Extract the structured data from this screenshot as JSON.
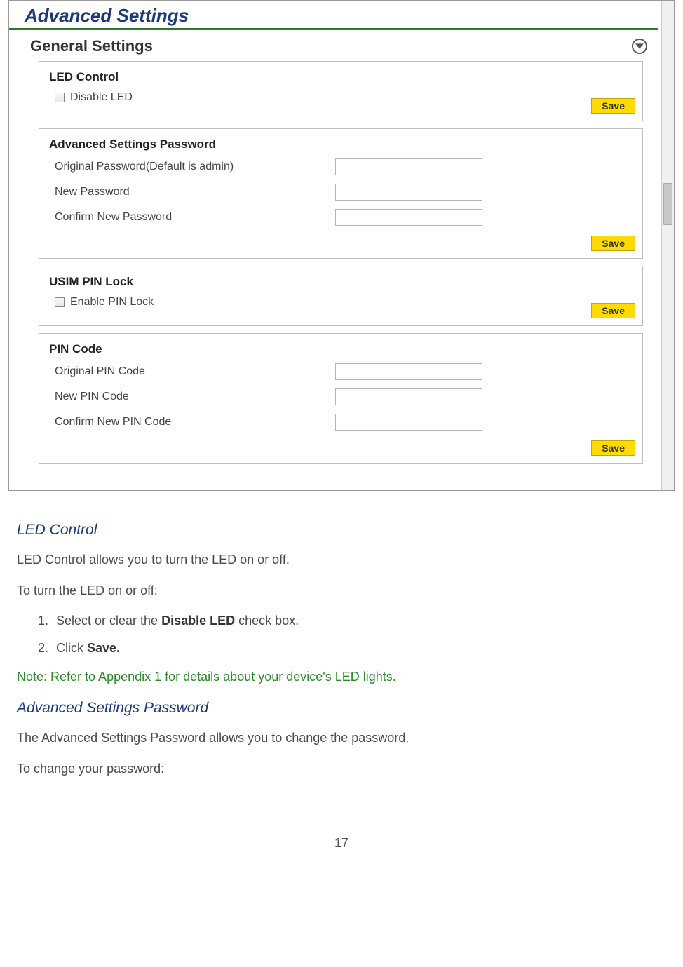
{
  "screenshot": {
    "title": "Advanced Settings",
    "section_title": "General Settings",
    "panels": {
      "led_control": {
        "title": "LED Control",
        "checkbox_label": "Disable LED",
        "save": "Save"
      },
      "password": {
        "title": "Advanced Settings Password",
        "fields": {
          "original": "Original Password(Default is admin)",
          "new": "New Password",
          "confirm": "Confirm New Password"
        },
        "save": "Save"
      },
      "pin_lock": {
        "title": "USIM PIN Lock",
        "checkbox_label": "Enable PIN Lock",
        "save": "Save"
      },
      "pin_code": {
        "title": "PIN Code",
        "fields": {
          "original": "Original PIN Code",
          "new": "New PIN Code",
          "confirm": "Confirm New PIN Code"
        },
        "save": "Save"
      }
    }
  },
  "doc": {
    "led_control": {
      "heading": "LED Control",
      "intro": "LED Control allows you to turn the LED on or off.",
      "steps_intro": "To turn the LED on or off:",
      "steps": {
        "s1_pre": "Select or clear the ",
        "s1_bold": "Disable LED",
        "s1_post": " check box.",
        "s2_pre": "Click ",
        "s2_bold": "Save."
      },
      "note": "Note: Refer to Appendix 1 for details about your device's LED lights."
    },
    "advanced_password": {
      "heading": "Advanced Settings Password",
      "intro": "The Advanced Settings Password allows you to change the password.",
      "steps_intro": "To change your password:"
    }
  },
  "page_number": "17"
}
